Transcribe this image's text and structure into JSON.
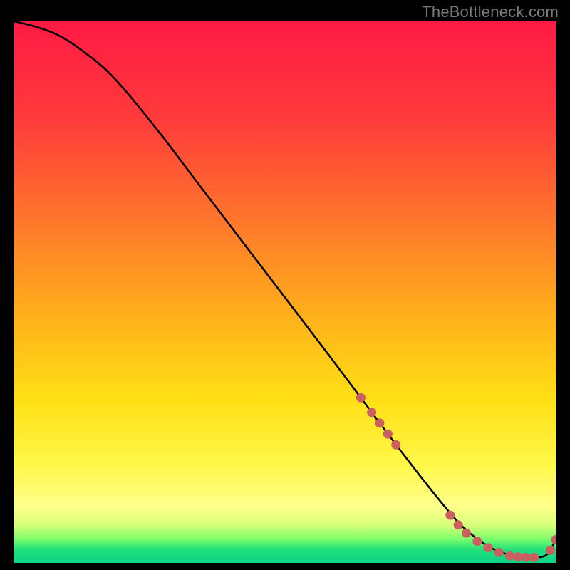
{
  "attribution": "TheBottleneck.com",
  "chart_data": {
    "type": "line",
    "title": "",
    "xlabel": "",
    "ylabel": "",
    "xlim": [
      0,
      100
    ],
    "ylim": [
      0,
      100
    ],
    "gradient_stops": [
      {
        "offset": 0.0,
        "color": "#ff1a44"
      },
      {
        "offset": 0.18,
        "color": "#ff3b3b"
      },
      {
        "offset": 0.38,
        "color": "#ff7a2a"
      },
      {
        "offset": 0.55,
        "color": "#ffb21a"
      },
      {
        "offset": 0.7,
        "color": "#ffe015"
      },
      {
        "offset": 0.82,
        "color": "#fff84a"
      },
      {
        "offset": 0.895,
        "color": "#ffff8a"
      },
      {
        "offset": 0.93,
        "color": "#d8ff7a"
      },
      {
        "offset": 0.955,
        "color": "#7fff6a"
      },
      {
        "offset": 0.975,
        "color": "#22e07a"
      },
      {
        "offset": 1.0,
        "color": "#0bd488"
      }
    ],
    "series": [
      {
        "name": "bottleneck-curve",
        "x": [
          0,
          4,
          8,
          12,
          18,
          26,
          34,
          42,
          50,
          58,
          64,
          70,
          75,
          79,
          82,
          85,
          88,
          91,
          94,
          96.5,
          98,
          99,
          100
        ],
        "y": [
          100,
          99,
          97.5,
          95,
          90,
          80.5,
          70,
          59.5,
          49,
          38.5,
          30.5,
          22.5,
          16,
          11,
          7.5,
          4.8,
          2.8,
          1.6,
          1.1,
          1.0,
          1.3,
          2.3,
          4.3
        ]
      }
    ],
    "markers": {
      "name": "highlight-dots",
      "color": "#c9605f",
      "radius": 6.5,
      "points": [
        {
          "x": 64.0,
          "y": 30.5
        },
        {
          "x": 66.0,
          "y": 27.8
        },
        {
          "x": 67.5,
          "y": 25.8
        },
        {
          "x": 69.0,
          "y": 23.8
        },
        {
          "x": 70.5,
          "y": 21.8
        },
        {
          "x": 80.5,
          "y": 8.8
        },
        {
          "x": 82.0,
          "y": 7.0
        },
        {
          "x": 83.5,
          "y": 5.5
        },
        {
          "x": 85.5,
          "y": 4.0
        },
        {
          "x": 87.5,
          "y": 2.8
        },
        {
          "x": 89.5,
          "y": 1.9
        },
        {
          "x": 91.5,
          "y": 1.3
        },
        {
          "x": 93.0,
          "y": 1.1
        },
        {
          "x": 94.5,
          "y": 1.0
        },
        {
          "x": 96.0,
          "y": 1.0
        },
        {
          "x": 99.0,
          "y": 2.3
        },
        {
          "x": 100.0,
          "y": 4.3
        }
      ]
    }
  }
}
